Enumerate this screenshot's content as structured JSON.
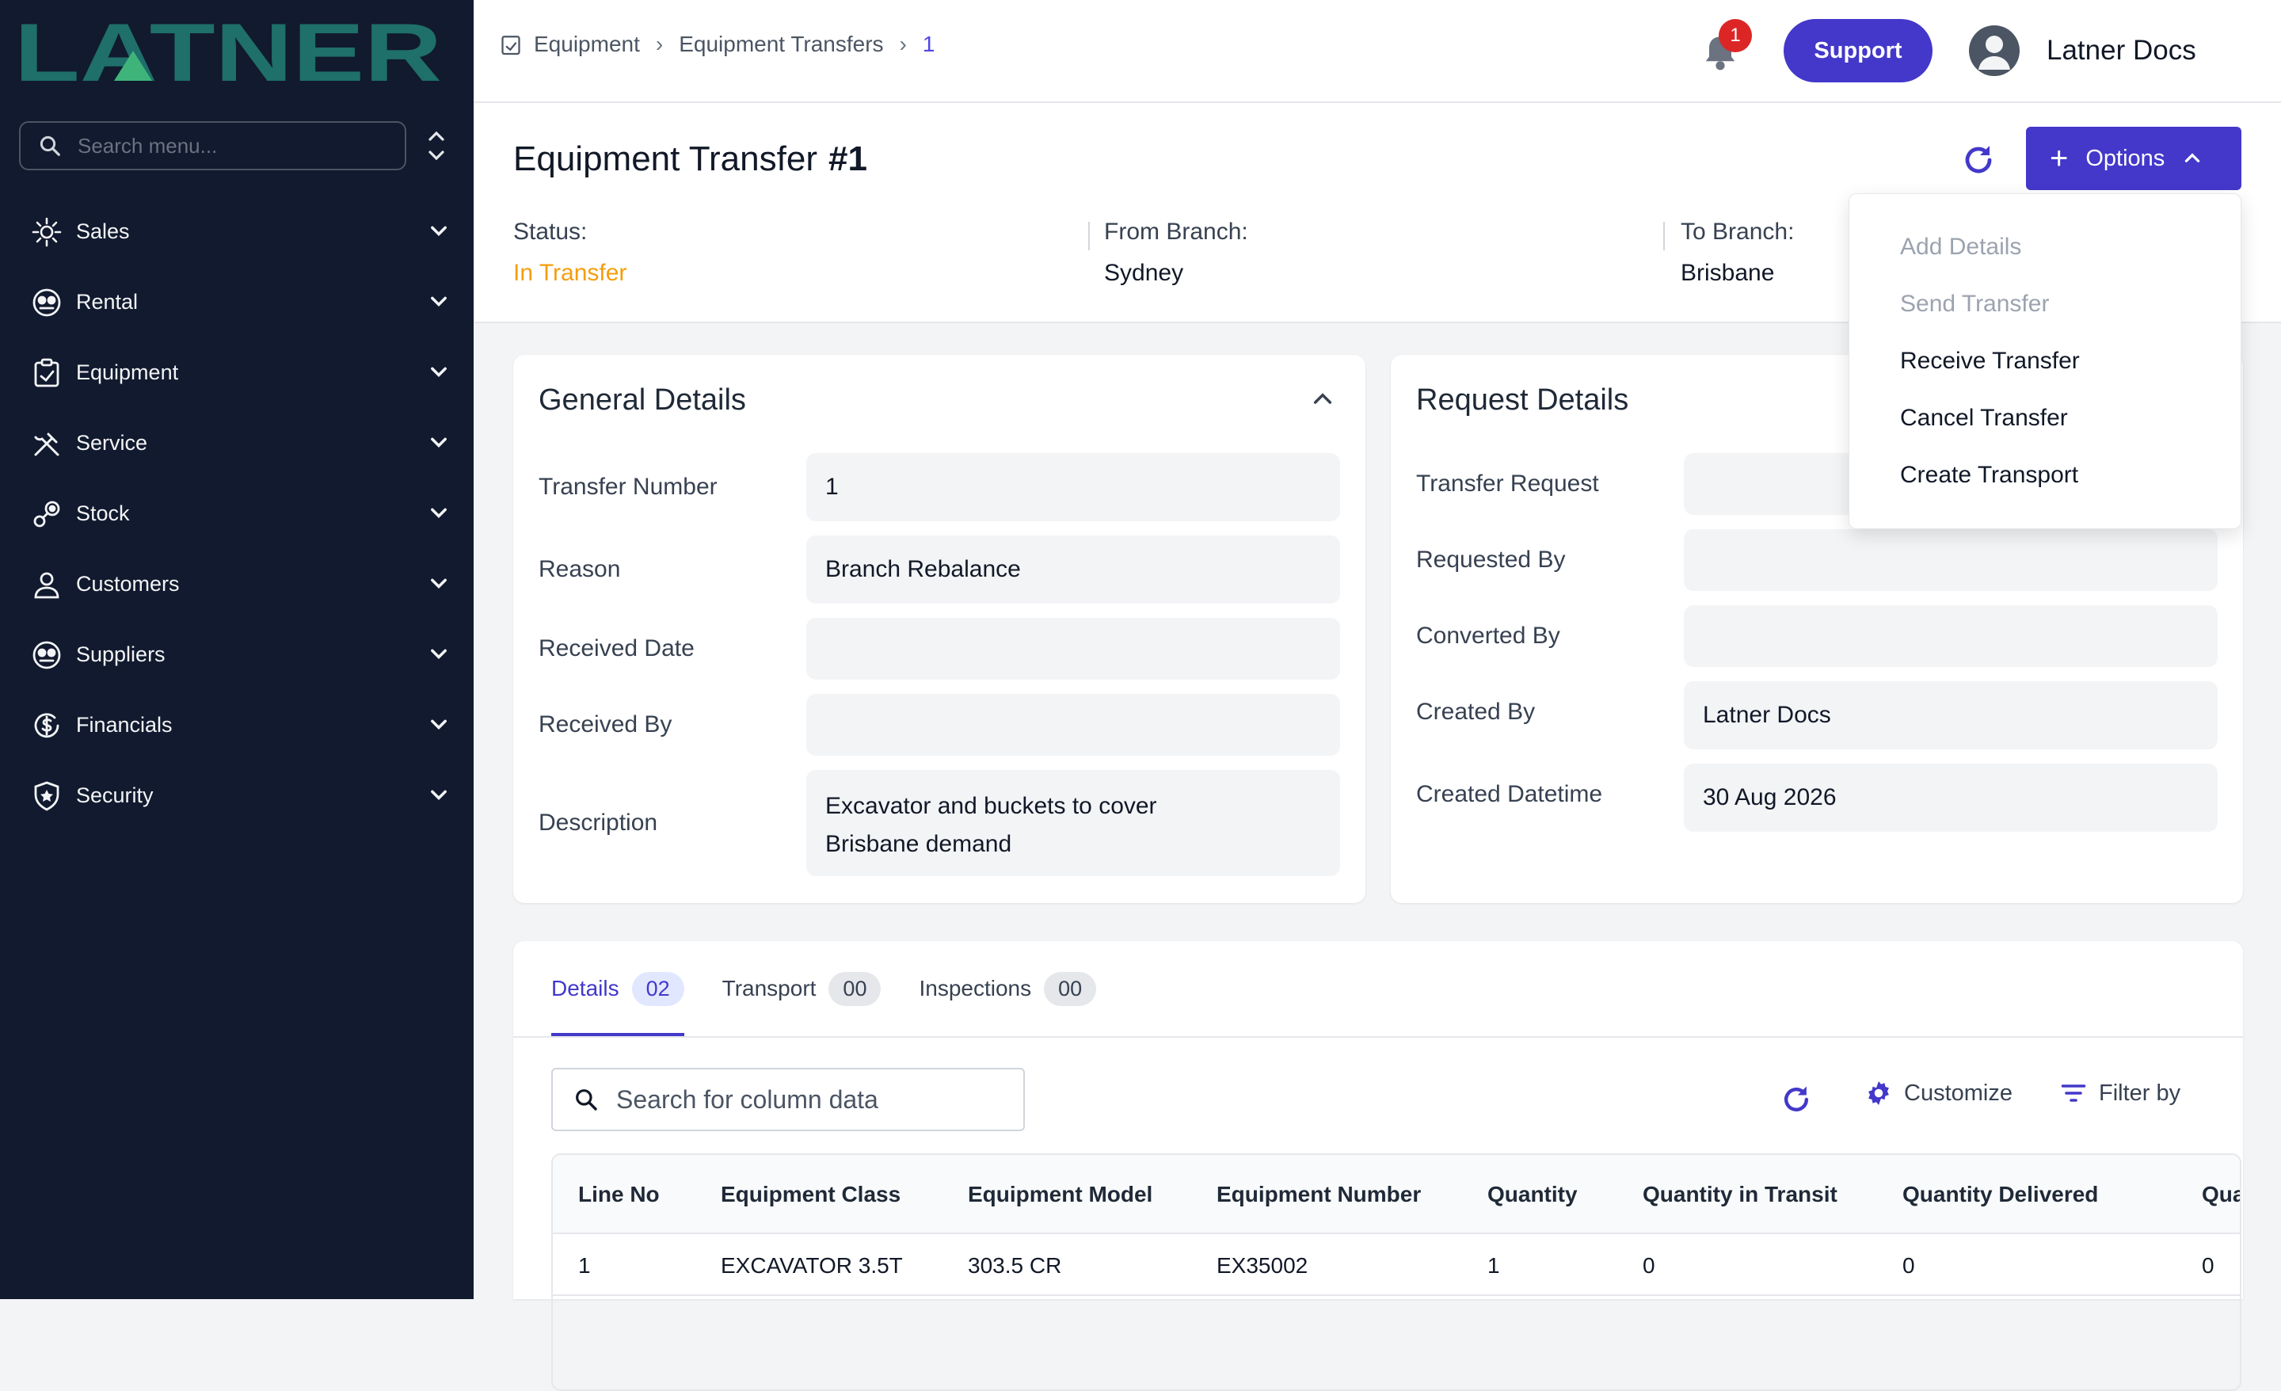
{
  "brand": {
    "name": "LATNER",
    "accent": "#1f6f6a",
    "triangle": "#3fb47a"
  },
  "sidebar": {
    "search_placeholder": "Search menu...",
    "items": [
      {
        "label": "Sales",
        "icon": "sales-icon"
      },
      {
        "label": "Rental",
        "icon": "rental-icon"
      },
      {
        "label": "Equipment",
        "icon": "equipment-icon"
      },
      {
        "label": "Service",
        "icon": "tools-icon"
      },
      {
        "label": "Stock",
        "icon": "stock-icon"
      },
      {
        "label": "Customers",
        "icon": "user-icon"
      },
      {
        "label": "Suppliers",
        "icon": "suppliers-icon"
      },
      {
        "label": "Financials",
        "icon": "dollar-icon"
      },
      {
        "label": "Security",
        "icon": "shield-icon"
      }
    ]
  },
  "topbar": {
    "breadcrumb": [
      "Equipment",
      "Equipment Transfers",
      "1"
    ],
    "notification_count": "1",
    "support_label": "Support",
    "user_name": "Latner Docs"
  },
  "header": {
    "title": "Equipment Transfer",
    "number": "#1",
    "options_label": "Options",
    "status_label": "Status:",
    "status_value": "In Transfer",
    "from_label": "From Branch:",
    "from_value": "Sydney",
    "to_label": "To Branch:",
    "to_value": "Brisbane"
  },
  "options_menu": [
    {
      "label": "Add Details",
      "enabled": false
    },
    {
      "label": "Send Transfer",
      "enabled": false
    },
    {
      "label": "Receive Transfer",
      "enabled": true
    },
    {
      "label": "Cancel Transfer",
      "enabled": true
    },
    {
      "label": "Create Transport",
      "enabled": true
    }
  ],
  "general": {
    "title": "General Details",
    "transfer_number_label": "Transfer Number",
    "transfer_number": "1",
    "reason_label": "Reason",
    "reason": "Branch Rebalance",
    "received_date_label": "Received Date",
    "received_date": "",
    "received_by_label": "Received By",
    "received_by": "",
    "description_label": "Description",
    "description_line1": "Excavator and buckets to cover",
    "description_line2": "Brisbane demand"
  },
  "request": {
    "title": "Request Details",
    "transfer_request_label": "Transfer Request",
    "transfer_request": "",
    "requested_by_label": "Requested By",
    "requested_by": "",
    "converted_by_label": "Converted By",
    "converted_by": "",
    "created_by_label": "Created By",
    "created_by": "Latner Docs",
    "created_datetime_label": "Created Datetime",
    "created_datetime": "30 Aug 2026"
  },
  "tabs": [
    {
      "label": "Details",
      "count": "02",
      "active": true
    },
    {
      "label": "Transport",
      "count": "00",
      "active": false
    },
    {
      "label": "Inspections",
      "count": "00",
      "active": false
    }
  ],
  "table": {
    "search_placeholder": "Search for column data",
    "customize_label": "Customize",
    "filter_label": "Filter by",
    "columns": [
      "Line No",
      "Equipment Class",
      "Equipment Model",
      "Equipment Number",
      "Quantity",
      "Quantity in Transit",
      "Quantity Delivered",
      "Qua"
    ],
    "rows": [
      [
        "1",
        "EXCAVATOR 3.5T",
        "303.5 CR",
        "EX35002",
        "1",
        "0",
        "0",
        "0"
      ]
    ]
  }
}
